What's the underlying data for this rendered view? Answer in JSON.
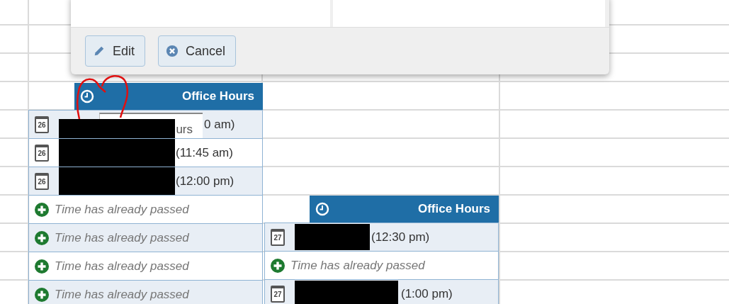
{
  "dialog": {
    "buttons": [
      {
        "kind": "edit",
        "label": "Edit"
      },
      {
        "kind": "cancel",
        "label": "Cancel"
      }
    ]
  },
  "blocks": [
    {
      "title": "Office Hours",
      "tooltip": "urs",
      "rows": [
        {
          "kind": "booking",
          "day": "26",
          "time": "0 am)"
        },
        {
          "kind": "booking",
          "day": "26",
          "time": "(11:45 am)"
        },
        {
          "kind": "booking",
          "day": "26",
          "time": "(12:00 pm)"
        },
        {
          "kind": "open",
          "text": "Time has already passed"
        },
        {
          "kind": "open",
          "text": "Time has already passed"
        },
        {
          "kind": "open",
          "text": "Time has already passed"
        },
        {
          "kind": "open",
          "text": "Time has already passed"
        }
      ]
    },
    {
      "title": "Office Hours",
      "rows": [
        {
          "kind": "booking",
          "day": "27",
          "time": "(12:30 pm)"
        },
        {
          "kind": "open",
          "text": "Time has already passed"
        },
        {
          "kind": "booking",
          "day": "27",
          "time": "(1:00 pm)"
        }
      ]
    }
  ]
}
